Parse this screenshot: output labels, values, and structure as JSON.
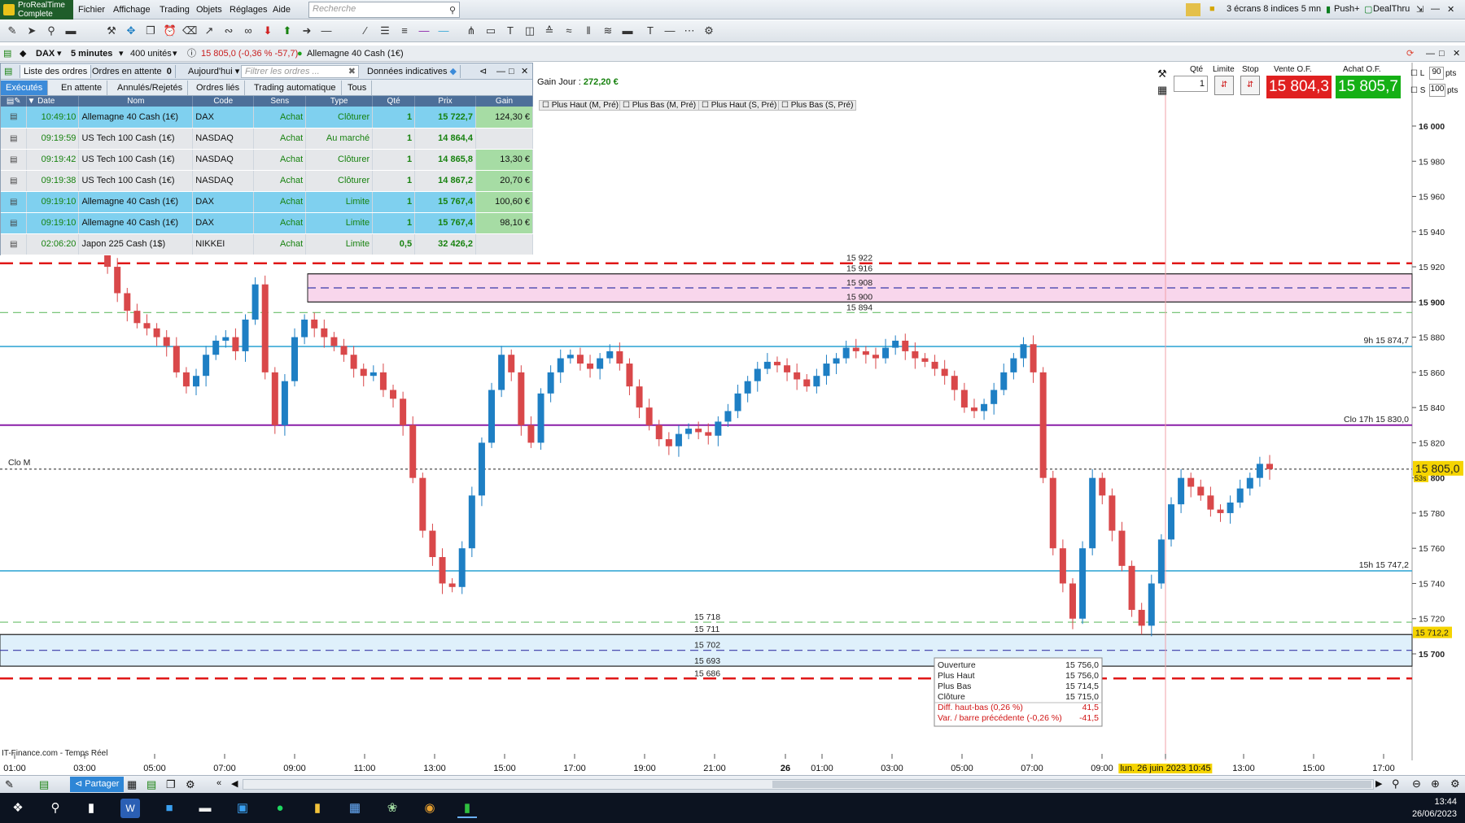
{
  "app": {
    "logo_line1": "ProRealTime",
    "logo_line2": "Complete",
    "menus": [
      "Fichier",
      "Affichage",
      "Trading",
      "Objets",
      "Réglages",
      "Aide"
    ],
    "search_placeholder": "Recherche",
    "screens_label": "3 écrans 8 indices 5 mn",
    "push_label": "Push+",
    "dealthru_label": "DealThru"
  },
  "chart_header": {
    "instrument": "DAX",
    "timeframe": "5 minutes",
    "units": "400 unités",
    "quote": "15 805,0 (-0,36 % -57,7)",
    "position_label": "Allemagne 40 Cash (1€)"
  },
  "orders_panel": {
    "tabs": [
      "Liste des ordres",
      "Ordres en attente",
      "Aujourd'hui"
    ],
    "pending_count": "0",
    "filter_placeholder": "Filtrer les ordres ...",
    "indicative_label": "Données indicatives",
    "subtabs": [
      "Exécutés",
      "En attente",
      "Annulés/Rejetés",
      "Ordres liés",
      "Trading automatique",
      "Tous"
    ],
    "columns": [
      "Date",
      "Nom",
      "Code",
      "Sens",
      "Type",
      "Qté",
      "Prix",
      "Gain"
    ],
    "rows": [
      {
        "date": "10:49:10",
        "nom": "Allemagne 40 Cash (1€)",
        "code": "DAX",
        "sens": "Achat",
        "type": "Clôturer",
        "qte": "1",
        "prix": "15 722,7",
        "gain": "124,30 €",
        "style": "blue"
      },
      {
        "date": "09:19:59",
        "nom": "US Tech 100 Cash (1€)",
        "code": "NASDAQ",
        "sens": "Achat",
        "type": "Au marché",
        "qte": "1",
        "prix": "14 864,4",
        "gain": "",
        "style": "grey"
      },
      {
        "date": "09:19:42",
        "nom": "US Tech 100 Cash (1€)",
        "code": "NASDAQ",
        "sens": "Achat",
        "type": "Clôturer",
        "qte": "1",
        "prix": "14 865,8",
        "gain": "13,30 €",
        "style": "grey"
      },
      {
        "date": "09:19:38",
        "nom": "US Tech 100 Cash (1€)",
        "code": "NASDAQ",
        "sens": "Achat",
        "type": "Clôturer",
        "qte": "1",
        "prix": "14 867,2",
        "gain": "20,70 €",
        "style": "grey"
      },
      {
        "date": "09:19:10",
        "nom": "Allemagne 40 Cash (1€)",
        "code": "DAX",
        "sens": "Achat",
        "type": "Limite",
        "qte": "1",
        "prix": "15 767,4",
        "gain": "100,60 €",
        "style": "blue"
      },
      {
        "date": "09:19:10",
        "nom": "Allemagne 40 Cash (1€)",
        "code": "DAX",
        "sens": "Achat",
        "type": "Limite",
        "qte": "1",
        "prix": "15 767,4",
        "gain": "98,10 €",
        "style": "blue"
      },
      {
        "date": "02:06:20",
        "nom": "Japon 225 Cash (1$)",
        "code": "NIKKEI",
        "sens": "Achat",
        "type": "Limite",
        "qte": "0,5",
        "prix": "32 426,2",
        "gain": "",
        "style": "grey"
      }
    ]
  },
  "trade_box": {
    "gain_label": "Gain Jour :",
    "gain_value": "272,20 €",
    "qty_label": "Qté",
    "qty_value": "1",
    "limit_label": "Limite",
    "stop_label": "Stop",
    "sell_label": "Vente O.F.",
    "buy_label": "Achat O.F.",
    "sell_price": "15 804,3",
    "buy_price": "15 805,7",
    "l_label": "L",
    "l_value": "90",
    "s_label": "S",
    "s_value": "100",
    "pts": "pts"
  },
  "legend_checkboxes": [
    "Plus Haut (M, Pré)",
    "Plus Bas (M, Pré)",
    "Plus Haut (S, Pré)",
    "Plus Bas (S, Pré)"
  ],
  "chart_data": {
    "type": "candlestick",
    "y_ticks": [
      "16 000",
      "15 980",
      "15 960",
      "15 940",
      "15 920",
      "15 900",
      "15 880",
      "15 860",
      "15 840",
      "15 820",
      "15 800",
      "15 780",
      "15 760",
      "15 740",
      "15 720",
      "15 700"
    ],
    "ylim": [
      15680,
      16010
    ],
    "x_ticks": [
      "01:00",
      "03:00",
      "05:00",
      "07:00",
      "09:00",
      "11:00",
      "13:00",
      "15:00",
      "17:00",
      "19:00",
      "21:00",
      "26",
      "01:00",
      "03:00",
      "05:00",
      "07:00",
      "09:00",
      "lun. 26 juin 2023 10:45",
      "13:00",
      "15:00",
      "17:00"
    ],
    "current_price": "15 805,0",
    "current_tag": "15 805,0",
    "countdown": "53s",
    "price_level_tag": "15 712,2",
    "levels": [
      {
        "label": "15 922",
        "value": 15922,
        "style": "red-dash"
      },
      {
        "label": "15 916",
        "value": 15916,
        "style": "solid-dark"
      },
      {
        "label": "15 908",
        "value": 15908,
        "style": "blue-dash"
      },
      {
        "label": "15 900",
        "value": 15900,
        "style": "solid-dark"
      },
      {
        "label": "15 894",
        "value": 15894,
        "style": "green-dash"
      },
      {
        "label": "9h 15 874,7",
        "value": 15874.7,
        "style": "cyan"
      },
      {
        "label": "Clo 17h 15 830,0",
        "value": 15830,
        "style": "purple"
      },
      {
        "label": "Clo M",
        "value": 15805,
        "style": "black-dot"
      },
      {
        "label": "15h 15 747,2",
        "value": 15747.2,
        "style": "cyan"
      },
      {
        "label": "15 718",
        "value": 15718,
        "style": "green-dash"
      },
      {
        "label": "15 711",
        "value": 15711,
        "style": "solid-dark"
      },
      {
        "label": "15 702",
        "value": 15702,
        "style": "blue-dash"
      },
      {
        "label": "15 693",
        "value": 15693,
        "style": "solid-dark"
      },
      {
        "label": "15 686",
        "value": 15686,
        "style": "red-dash"
      }
    ],
    "close_series": [
      15960,
      15920,
      15905,
      15895,
      15888,
      15885,
      15880,
      15875,
      15860,
      15852,
      15858,
      15870,
      15878,
      15880,
      15872,
      15890,
      15910,
      15860,
      15830,
      15855,
      15880,
      15890,
      15885,
      15880,
      15875,
      15870,
      15862,
      15858,
      15860,
      15850,
      15845,
      15830,
      15800,
      15770,
      15755,
      15740,
      15738,
      15760,
      15790,
      15820,
      15850,
      15870,
      15860,
      15830,
      15820,
      15848,
      15860,
      15868,
      15870,
      15865,
      15862,
      15868,
      15872,
      15865,
      15852,
      15840,
      15830,
      15822,
      15818,
      15825,
      15828,
      15826,
      15824,
      15832,
      15838,
      15848,
      15855,
      15862,
      15866,
      15864,
      15860,
      15856,
      15852,
      15858,
      15865,
      15868,
      15874,
      15872,
      15870,
      15868,
      15874,
      15878,
      15872,
      15868,
      15866,
      15862,
      15858,
      15850,
      15840,
      15838,
      15842,
      15850,
      15860,
      15868,
      15876,
      15860,
      15800,
      15760,
      15740,
      15720,
      15760,
      15800,
      15790,
      15770,
      15750,
      15725,
      15716,
      15740,
      15765,
      15785,
      15800,
      15795,
      15790,
      15782,
      15780,
      15786,
      15794,
      15800,
      15808,
      15805
    ],
    "info_box": {
      "rows": [
        {
          "k": "Ouverture",
          "v": "15 756,0"
        },
        {
          "k": "Plus Haut",
          "v": "15 756,0"
        },
        {
          "k": "Plus Bas",
          "v": "15 714,5"
        },
        {
          "k": "Clôture",
          "v": "15 715,0"
        },
        {
          "k": "Diff. haut-bas (0,26 %)",
          "v": "41,5"
        },
        {
          "k": "Var. / barre précédente (-0,26 %)",
          "v": "-41,5"
        }
      ]
    },
    "source": "IT-Finance.com - Temps Réel"
  },
  "bottom": {
    "share_label": "Partager"
  },
  "taskbar": {
    "time": "13:44",
    "date": "26/06/2023"
  },
  "colors": {
    "up": "#1e7fc4",
    "down": "#d9484a",
    "sell": "#e02020",
    "buy": "#15b015",
    "purple": "#8a1fa8",
    "cyan": "#39a9d6"
  }
}
